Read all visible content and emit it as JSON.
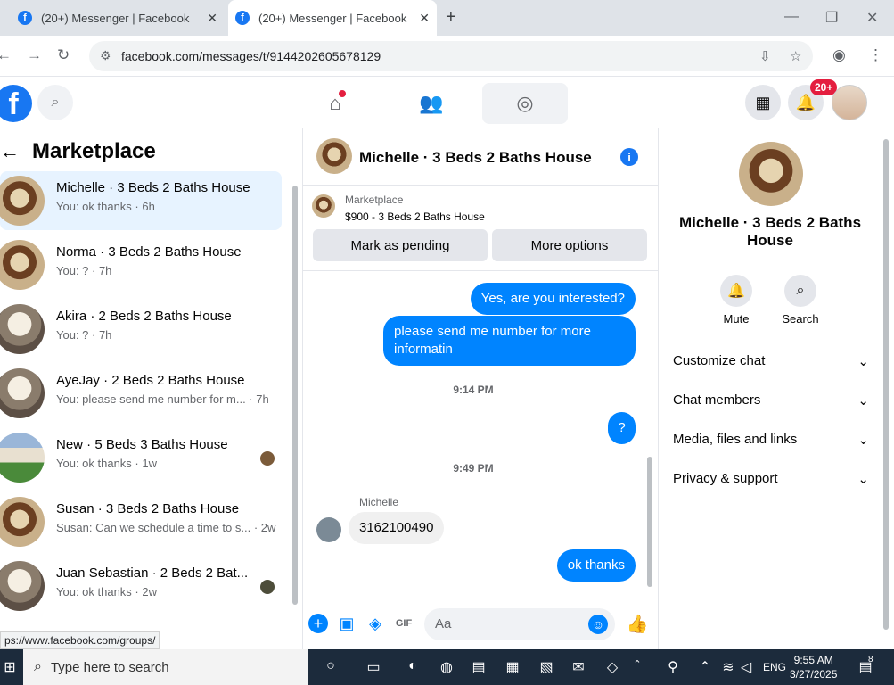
{
  "browser": {
    "tabs": [
      {
        "title": "(20+) Messenger | Facebook"
      },
      {
        "title": "(20+) Messenger | Facebook"
      }
    ],
    "url": "facebook.com/messages/t/9144202605678129"
  },
  "fb_header": {
    "notif_badge": "20+",
    "brand_color": "#1877f2"
  },
  "left_panel": {
    "title": "Marketplace",
    "conversations": [
      {
        "name": "Michelle · 3 Beds 2 Baths House",
        "snippet": "You: ok thanks · 6h",
        "selected": true
      },
      {
        "name": "Norma · 3 Beds 2 Baths House",
        "snippet": "You: ? · 7h"
      },
      {
        "name": "Akira · 2 Beds 2 Baths House",
        "snippet": "You: ? · 7h"
      },
      {
        "name": "AyeJay · 2 Beds 2 Baths House",
        "snippet": "You: please send me number for m... · 7h"
      },
      {
        "name": "New · 5 Beds 3 Baths House",
        "snippet": "You: ok thanks · 1w"
      },
      {
        "name": "Susan · 3 Beds 2 Baths House",
        "snippet": "Susan: Can we schedule a time to s... · 2w"
      },
      {
        "name": "Juan Sebastian · 2 Beds 2 Bat...",
        "snippet": "You: ok thanks · 2w"
      }
    ],
    "status_url": "ps://www.facebook.com/groups/"
  },
  "chat": {
    "title": "Michelle · 3 Beds 2 Baths House",
    "listing_label": "Marketplace",
    "listing_detail": "$900 - 3 Beds 2 Baths House",
    "mark_pending": "Mark as pending",
    "more_options": "More options",
    "messages": {
      "m1": "Yes, are you interested?",
      "m2": "please send me number for more informatin",
      "ts1": "9:14 PM",
      "m3": "?",
      "ts2": "9:49 PM",
      "sender": "Michelle",
      "m4": "3162100490",
      "m5": "ok thanks"
    },
    "composer_placeholder": "Aa"
  },
  "right_panel": {
    "name": "Michelle · 3 Beds 2 Baths House",
    "mute": "Mute",
    "search": "Search",
    "sections": [
      "Customize chat",
      "Chat members",
      "Media, files and links",
      "Privacy & support"
    ]
  },
  "taskbar": {
    "search_placeholder": "Type here to search",
    "lang": "ENG",
    "time": "9:55 AM",
    "date": "3/27/2025",
    "notif_count": "8"
  }
}
